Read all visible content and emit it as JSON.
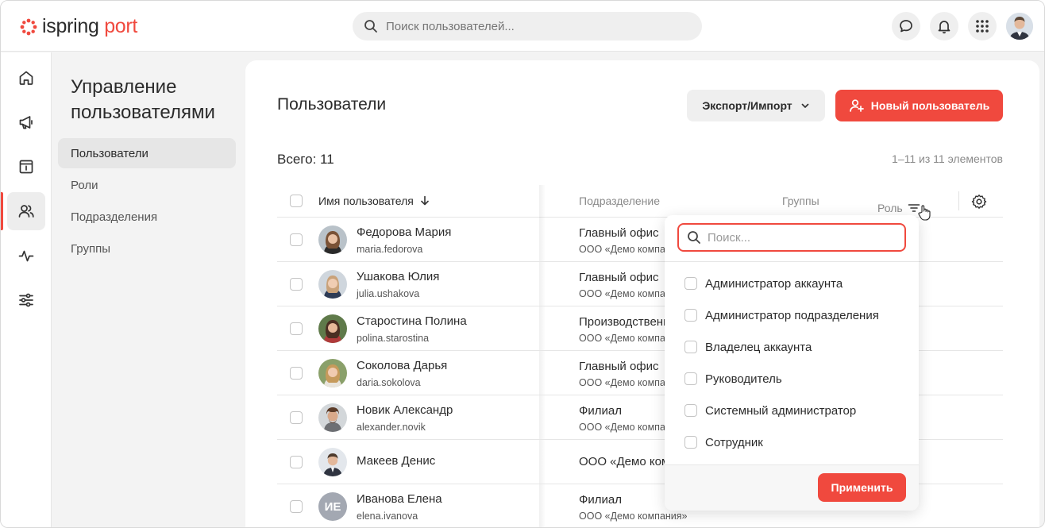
{
  "brand": {
    "name_part1": "ispring",
    "name_part2": "port",
    "accent": "#f0493e"
  },
  "header": {
    "search_placeholder": "Поиск пользователей...",
    "icons": [
      "chat-icon",
      "bell-icon",
      "apps-grid-icon"
    ]
  },
  "rail": {
    "items": [
      {
        "icon": "home-icon",
        "active": false
      },
      {
        "icon": "megaphone-icon",
        "active": false
      },
      {
        "icon": "catalog-icon",
        "active": false
      },
      {
        "icon": "users-icon",
        "active": true
      },
      {
        "icon": "activity-icon",
        "active": false
      },
      {
        "icon": "settings-sliders-icon",
        "active": false
      }
    ]
  },
  "section": {
    "title": "Управление пользователями",
    "items": [
      {
        "label": "Пользователи",
        "active": true
      },
      {
        "label": "Роли",
        "active": false
      },
      {
        "label": "Подразделения",
        "active": false
      },
      {
        "label": "Группы",
        "active": false
      }
    ]
  },
  "main": {
    "title": "Пользователи",
    "export_label": "Экспорт/Импорт",
    "new_user_label": "Новый пользователь",
    "total_label": "Всего: 11",
    "pager_label": "1–11 из 11 элементов"
  },
  "table": {
    "columns": {
      "name": "Имя пользователя",
      "department": "Подразделение",
      "groups": "Группы",
      "role": "Роль"
    },
    "rows": [
      {
        "name": "Федорова Мария",
        "login": "maria.fedorova",
        "dept": "Главный офис",
        "dept_sub": "ООО «Демо компания»"
      },
      {
        "name": "Ушакова Юлия",
        "login": "julia.ushakova",
        "dept": "Главный офис",
        "dept_sub": "ООО «Демо компания»"
      },
      {
        "name": "Старостина Полина",
        "login": "polina.starostina",
        "dept": "Производственный отдел",
        "dept_sub": "ООО «Демо компания»"
      },
      {
        "name": "Соколова Дарья",
        "login": "daria.sokolova",
        "dept": "Главный офис",
        "dept_sub": "ООО «Демо компания»"
      },
      {
        "name": "Новик Александр",
        "login": "alexander.novik",
        "dept": "Филиал",
        "dept_sub": "ООО «Демо компания»"
      },
      {
        "name": "Макеев Денис",
        "login": "",
        "dept": "ООО «Демо компания»",
        "dept_sub": ""
      },
      {
        "name": "Иванова Елена",
        "login": "elena.ivanova",
        "dept": "Филиал",
        "dept_sub": "ООО «Демо компания»",
        "initials": "ИЕ"
      }
    ]
  },
  "role_filter": {
    "search_placeholder": "Поиск...",
    "options": [
      "Администратор аккаунта",
      "Администратор подразделения",
      "Владелец аккаунта",
      "Руководитель",
      "Системный администратор",
      "Сотрудник"
    ],
    "apply_label": "Применить"
  }
}
